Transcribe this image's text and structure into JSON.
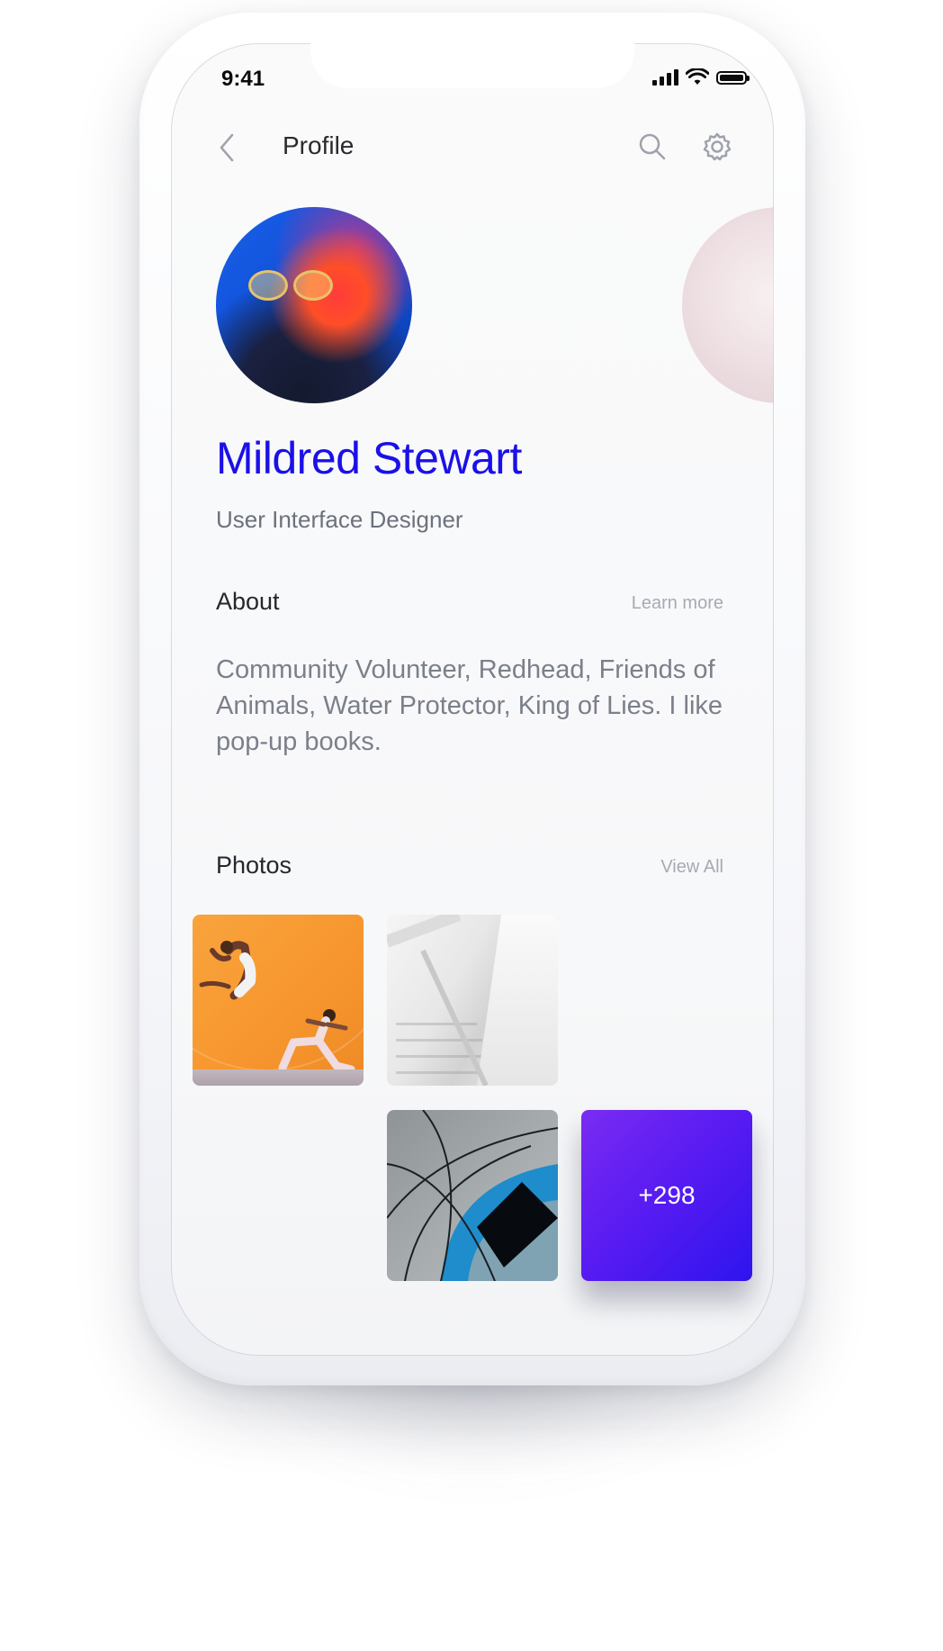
{
  "status_bar": {
    "time": "9:41"
  },
  "header": {
    "title": "Profile",
    "icons": [
      "chevron-left-icon",
      "search-icon",
      "gear-icon"
    ]
  },
  "profile": {
    "name": "Mildred Stewart",
    "role": "User Interface Designer"
  },
  "about": {
    "title": "About",
    "link": "Learn more",
    "text": "Community Volunteer, Redhead, Friends of Animals, Water Protector, King of Lies. I like pop-up books."
  },
  "photos": {
    "title": "Photos",
    "link": "View All",
    "more_count": "+298"
  },
  "colors": {
    "accent": "#1a10e8",
    "more_tile_start": "#7a2cf2",
    "more_tile_end": "#2e14ee"
  }
}
